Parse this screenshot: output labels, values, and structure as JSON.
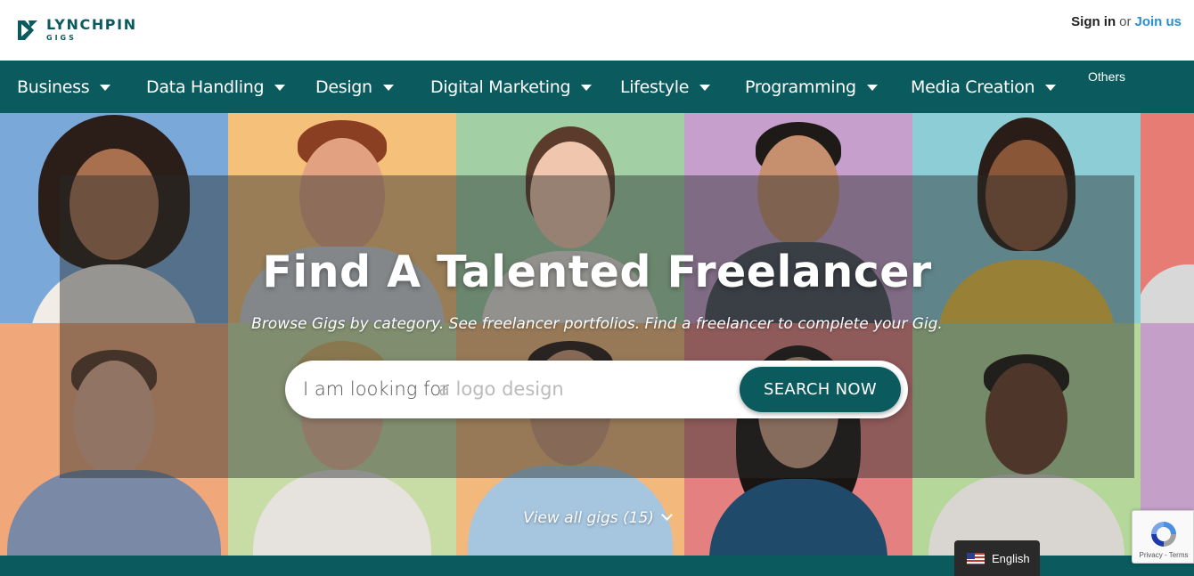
{
  "brand": {
    "name": "LYNCHPIN",
    "sub": "GIGS",
    "color": "#0b5a5e"
  },
  "auth": {
    "signin": "Sign in",
    "or": "or",
    "join": "Join us"
  },
  "nav": {
    "items": [
      {
        "label": "Business"
      },
      {
        "label": "Data Handling"
      },
      {
        "label": "Design"
      },
      {
        "label": "Digital Marketing"
      },
      {
        "label": "Lifestyle"
      },
      {
        "label": "Programming"
      },
      {
        "label": "Media Creation"
      }
    ],
    "others": "Others"
  },
  "hero": {
    "title": "Find A Talented Freelancer",
    "subtitle": "Browse Gigs by category. See freelancer portfolios. Find a freelancer to complete your Gig.",
    "search_label": "I am looking for",
    "search_placeholder": "a logo design",
    "search_button": "SEARCH NOW",
    "view_all": "View all gigs (15)"
  },
  "language": {
    "selected": "English",
    "icon": "us-flag-icon"
  },
  "recaptcha": {
    "links": "Privacy - Terms"
  },
  "colors": {
    "accent": "#0b5a5e",
    "link": "#2a8fd0",
    "tiles": [
      "#7aa8d8",
      "#f5c07a",
      "#a3cfa5",
      "#c79fcc",
      "#8dcdd6",
      "#e77c74",
      "#f0a77a",
      "#c8dca5",
      "#f3b97c",
      "#e48080",
      "#b5d89a",
      "#c4a0c8"
    ]
  }
}
